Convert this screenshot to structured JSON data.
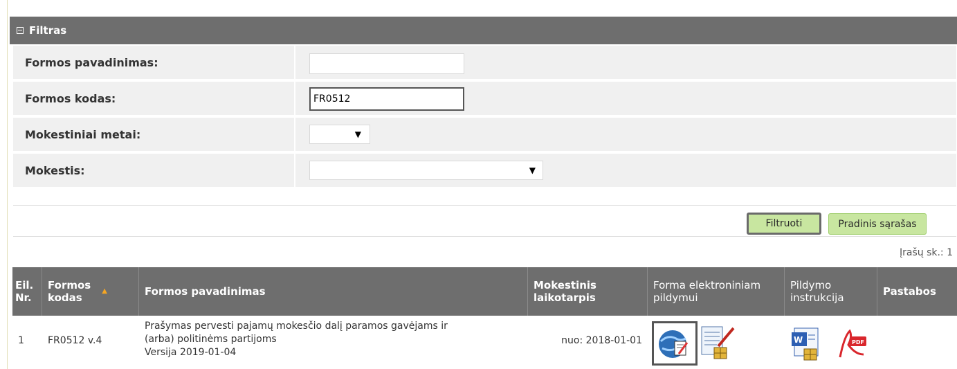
{
  "filter": {
    "title": "Filtras",
    "fields": [
      {
        "label": "Formos pavadinimas:",
        "value": ""
      },
      {
        "label": "Formos kodas:",
        "value": "FR0512"
      },
      {
        "label": "Mokestiniai metai:",
        "value": ""
      },
      {
        "label": "Mokestis:",
        "value": ""
      }
    ],
    "filter_button": "Filtruoti",
    "reset_button": "Pradinis sąrašas"
  },
  "records_count": "Įrašų sk.: 1",
  "table": {
    "headers": {
      "no": [
        "Eil.",
        "Nr."
      ],
      "code": [
        "Formos",
        "kodas"
      ],
      "name": "Formos pavadinimas",
      "period": [
        "Mokestinis",
        "laikotarpis"
      ],
      "electronic": [
        "Forma elektroniniam",
        "pildymui"
      ],
      "instructions": [
        "Pildymo",
        "instrukcija"
      ],
      "notes": "Pastabos"
    },
    "rows": [
      {
        "no": "1",
        "code": "FR0512 v.4",
        "name_line1": "Prašymas pervesti pajamų mokesčio dalį paramos gavėjams ir",
        "name_line2": "(arba) politinėms partijoms",
        "version": "Versija 2019-01-04",
        "period": "nuo: 2018-01-01",
        "icons": [
          "globe-form-icon",
          "form-edit-icon",
          "word-doc-icon",
          "pdf-icon"
        ],
        "notes": ""
      }
    ]
  },
  "colors": {
    "header_bg": "#6e6e6e",
    "button_bg": "#c8e6a0",
    "sort_arrow": "#f5a623"
  }
}
